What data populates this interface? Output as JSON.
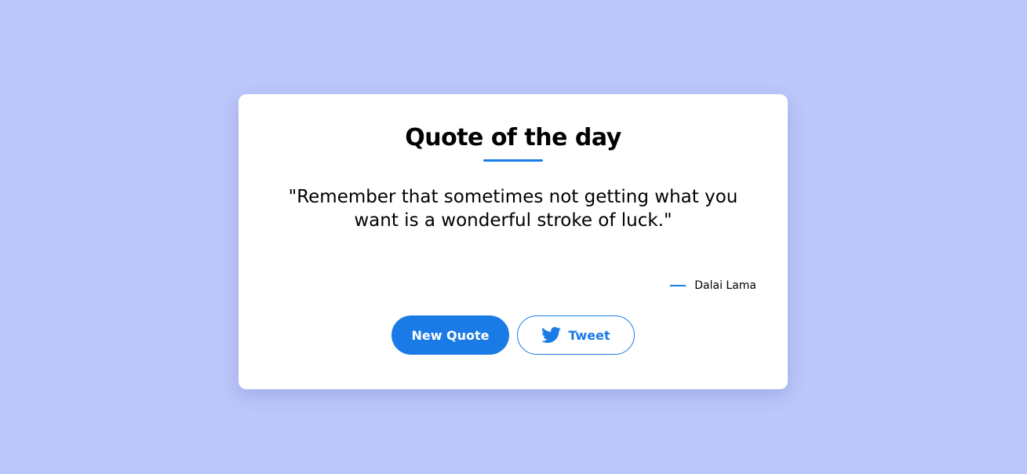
{
  "card": {
    "title": "Quote of the day",
    "quote": "\"Remember that sometimes not getting what you want is a wonderful stroke of luck.\"",
    "author": "Dalai Lama"
  },
  "buttons": {
    "new_quote_label": "New Quote",
    "tweet_label": "Tweet",
    "tweet_icon": "twitter-bird-icon"
  },
  "colors": {
    "background": "#bbc6fa",
    "accent": "#1a7be6",
    "card": "#ffffff"
  }
}
